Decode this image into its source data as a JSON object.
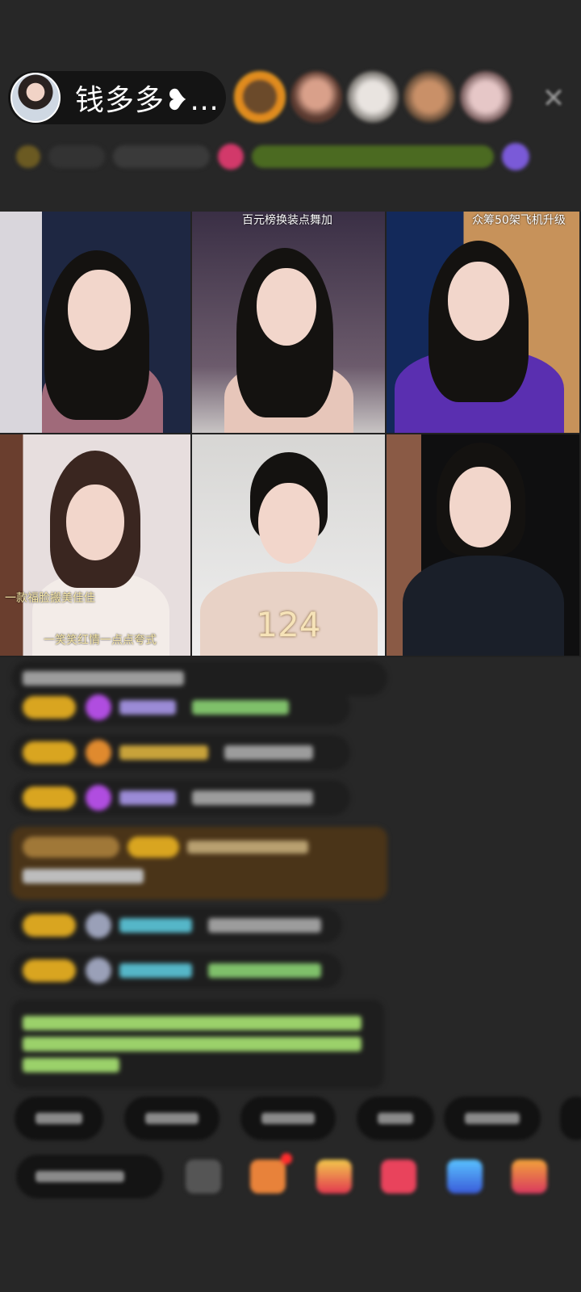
{
  "header": {
    "host_name": "钱多多❥…",
    "close_icon": "close-icon",
    "viewer_count": 5
  },
  "grid": {
    "tiles": [
      {
        "caption": ""
      },
      {
        "caption": "百元榜换装点舞加"
      },
      {
        "caption": "众筹50架飞机升级"
      },
      {
        "caption": "一款福脸搬美佳佳"
      },
      {
        "caption": "",
        "big_number": "124"
      },
      {
        "caption": ""
      }
    ],
    "tile4_sub_caption": "一笑笑红情一点点夸式"
  },
  "colors": {
    "background": "#272727",
    "level_badge": "#d9a520",
    "highlight_message": "#4a3418",
    "system_message_text": "#9bd16a"
  }
}
